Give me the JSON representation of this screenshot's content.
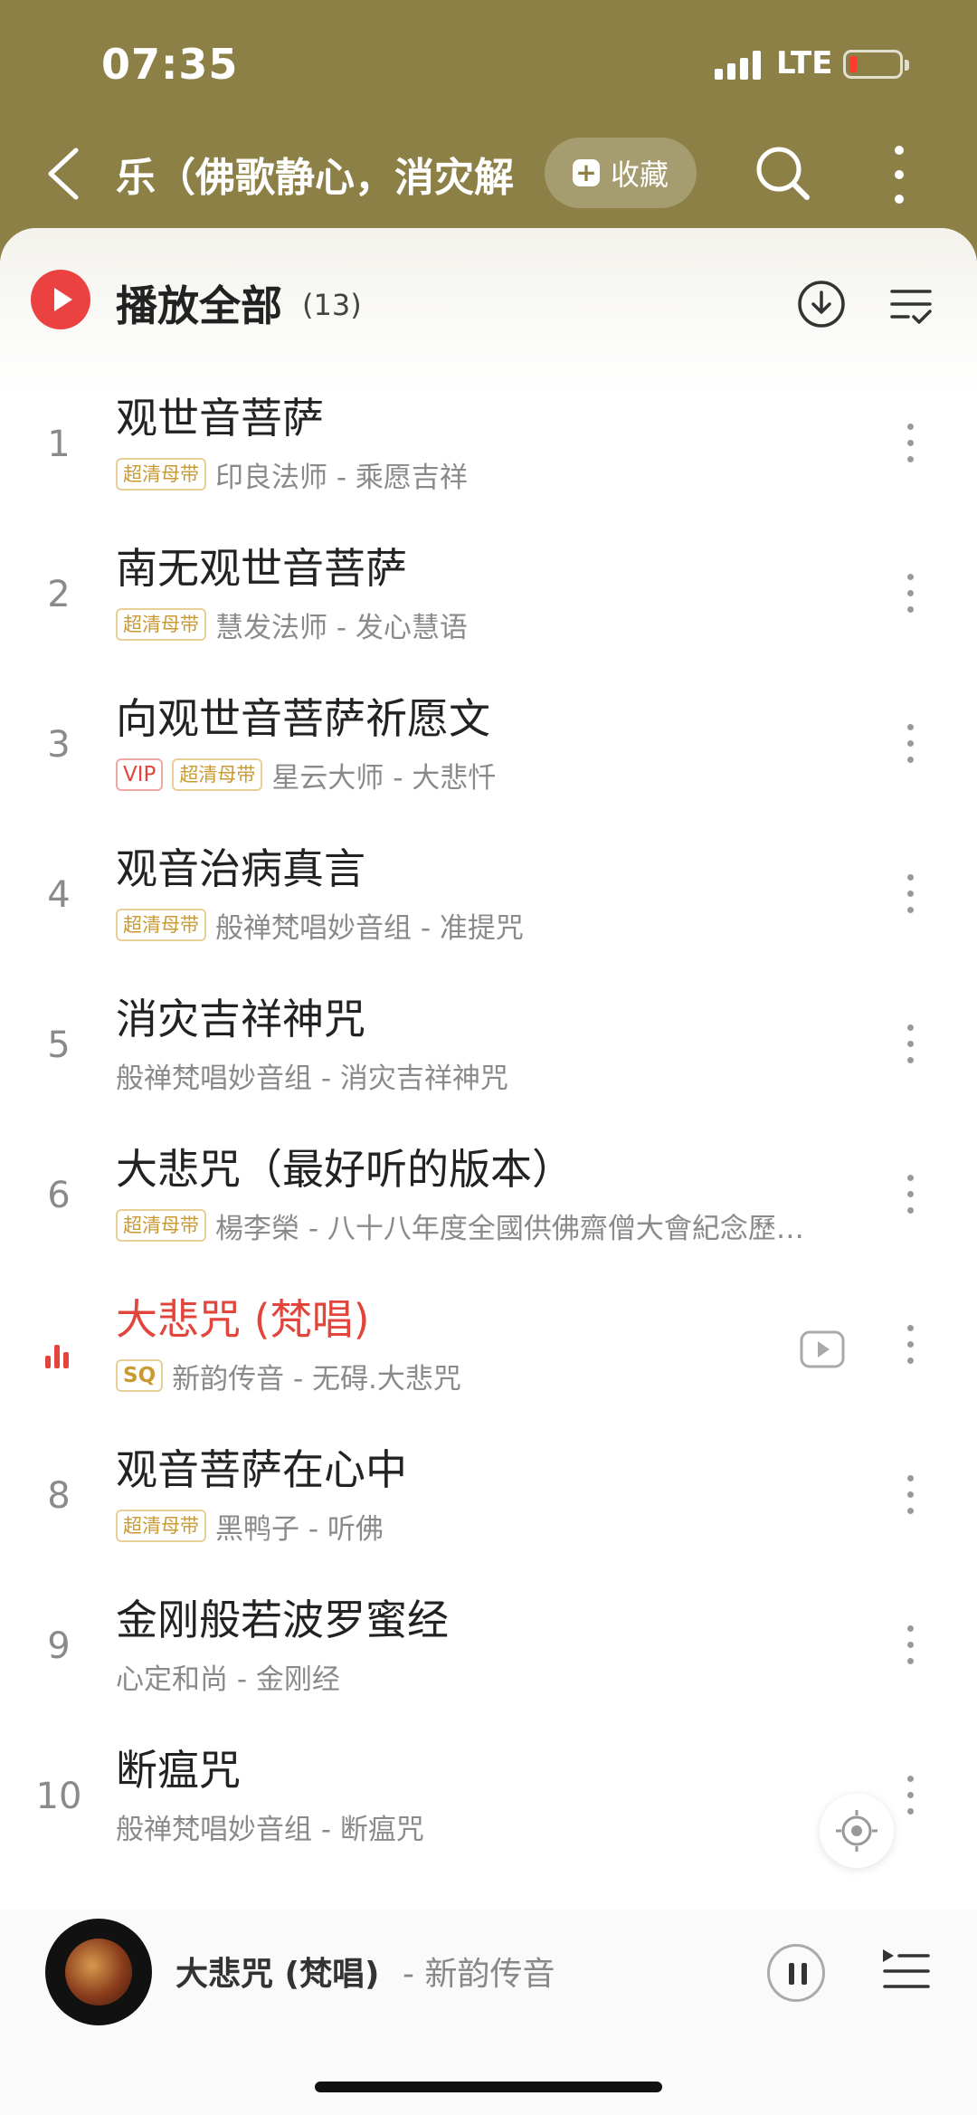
{
  "status_bar": {
    "time": "07:35",
    "network": "LTE"
  },
  "nav": {
    "title": "乐（佛歌静心，消灾解",
    "collect_label": "收藏"
  },
  "play_all": {
    "label": "播放全部",
    "count": "(13)"
  },
  "songs": [
    {
      "index": "1",
      "title": "观世音菩萨",
      "tags": [
        "超清母带"
      ],
      "artist": "印良法师 - 乘愿吉祥"
    },
    {
      "index": "2",
      "title": "南无观世音菩萨",
      "tags": [
        "超清母带"
      ],
      "artist": "慧发法师 - 发心慧语"
    },
    {
      "index": "3",
      "title": "向观世音菩萨祈愿文",
      "tags": [
        "VIP",
        "超清母带"
      ],
      "artist": "星云大师 - 大悲忏"
    },
    {
      "index": "4",
      "title": "观音治病真言",
      "tags": [
        "超清母带"
      ],
      "artist": "般禅梵唱妙音组 - 准提咒"
    },
    {
      "index": "5",
      "title": "消灾吉祥神咒",
      "tags": [],
      "artist": "般禅梵唱妙音组 - 消灾吉祥神咒"
    },
    {
      "index": "6",
      "title": "大悲咒（最好听的版本）",
      "tags": [
        "超清母带"
      ],
      "artist": "楊李榮 - 八十八年度全國供佛齋僧大會紀念歷…"
    },
    {
      "index": "",
      "title": "大悲咒 (梵唱)",
      "tags": [
        "SQ"
      ],
      "artist": "新韵传音 - 无碍.大悲咒",
      "playing": true
    },
    {
      "index": "8",
      "title": "观音菩萨在心中",
      "tags": [
        "超清母带"
      ],
      "artist": "黑鸭子 - 听佛"
    },
    {
      "index": "9",
      "title": "金刚般若波罗蜜经",
      "tags": [],
      "artist": "心定和尚 - 金刚经"
    },
    {
      "index": "10",
      "title": "断瘟咒",
      "tags": [],
      "artist": "般禅梵唱妙音组 - 断瘟咒"
    }
  ],
  "now_playing": {
    "title": "大悲咒 (梵唱)",
    "artist": "新韵传音"
  },
  "colors": {
    "header": "#8c8047",
    "accent": "#e2453c",
    "tag_gold": "#c99a33"
  }
}
